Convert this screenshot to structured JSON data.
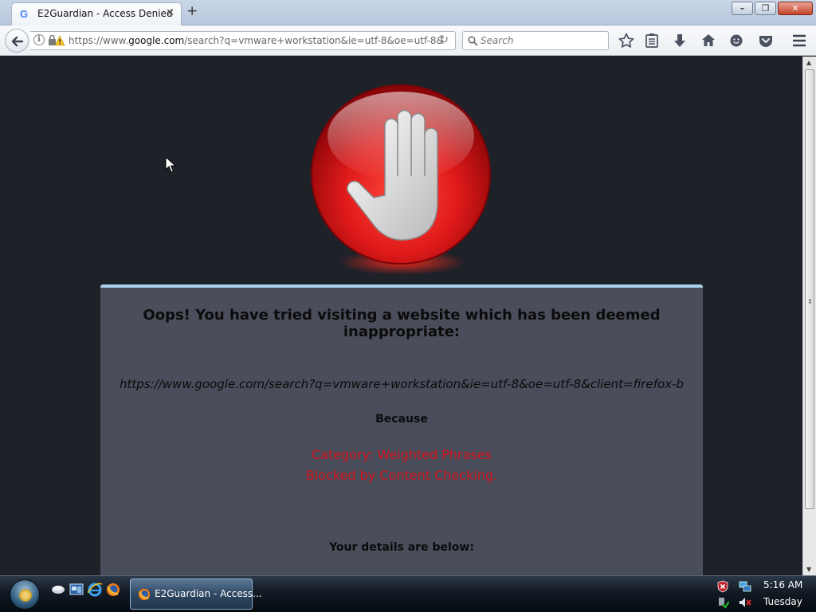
{
  "browser": {
    "tab": {
      "favicon": "G",
      "title": "E2Guardian - Access Denied",
      "close": "✕"
    },
    "new_tab": "+",
    "url": {
      "prefix": "https://www.",
      "host": "google.com",
      "path": "/search?q=vmware+workstation&ie=utf-8&oe=utf-8&"
    },
    "search": {
      "placeholder": "Search"
    },
    "toolbar_icons": [
      "bookmark-star-icon",
      "reading-list-icon",
      "download-icon",
      "home-icon",
      "hello-chat-icon",
      "pocket-icon",
      "menu-icon"
    ]
  },
  "page": {
    "heading": "Oops! You have tried visiting a website which has been deemed inappropriate:",
    "blocked_url": "https://www.google.com/search?q=vmware+workstation&ie=utf-8&oe=utf-8&client=firefox-b",
    "because_label": "Because",
    "category": "Category: Weighted Phrases",
    "reason": "Blocked by Content Checking.",
    "details_label": "Your details are below:",
    "accent_colors": {
      "stop_red": "#e01a1a",
      "reason_red": "#d0141e",
      "panel_border": "#a9d0ee"
    }
  },
  "taskbar": {
    "task_label": "E2Guardian - Access...",
    "clock_time": "5:16 AM",
    "clock_day": "Tuesday"
  }
}
